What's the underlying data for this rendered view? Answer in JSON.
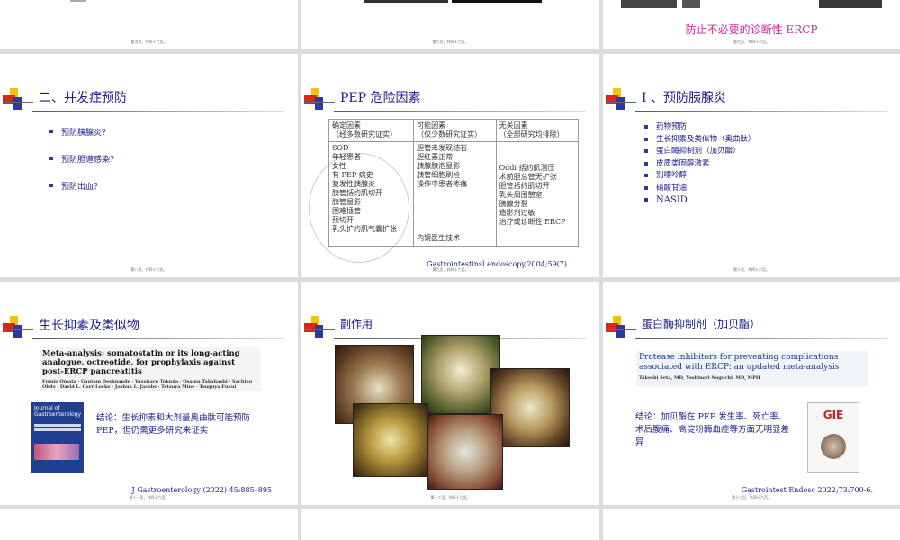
{
  "top_row": {
    "slide5_footer": "第五页，共四十六页。",
    "slide6_footer": "第六页，共四十六页。",
    "slide7_caption": "防止不必要的诊断性 ERCP",
    "slide7_footer": "第七页，共四十六页。"
  },
  "slide8": {
    "title": "二、并发症预防",
    "bullets": [
      "预防胰腺炎?",
      "预防胆道感染?",
      "预防出血?"
    ],
    "footer": "第八页，共四十六页。"
  },
  "slide9": {
    "title": "PEP 危险因素",
    "headers": [
      [
        "确定因素",
        "（经多数研究证实）"
      ],
      [
        "可能因素",
        "（仅少数研究证实）"
      ],
      [
        "无关因素",
        "（全部研究均排除）"
      ]
    ],
    "col1": [
      "SOD",
      "年轻患者",
      "女性",
      "有 PEP 病史",
      "复发性胰腺炎",
      "胰管括约肌切开",
      "胰管显影",
      "困难插管",
      "预切开",
      "乳头扩约肌气囊扩张"
    ],
    "col2": [
      "胆管未发现结石",
      "胆红素正常",
      "胰腺腺泡显影",
      "胰管细胞刷检",
      "操作中患者疼痛"
    ],
    "col2_bottom": "内镜医生技术",
    "col3": [
      "Oddi 括约肌测压",
      "术前胆总管无扩张",
      "胆管括约肌切开",
      "乳头周围憩室",
      "胰腺分裂",
      "造影剂过敏",
      "治疗或诊断性 ERCP"
    ],
    "reference": "Gastrointestinsl endoscopy,2004;59(7)",
    "footer": "第九页，共四十六页。"
  },
  "slide10": {
    "title": "I 、预防胰腺炎",
    "bullets": [
      "药物预防",
      "生长抑素及类似物（奥曲肽）",
      "蛋白酶抑制剂（加贝酯）",
      "皮质类固醇激素",
      "别嘌呤醇",
      "硝酸甘油",
      "NASID"
    ],
    "footer": "第十页，共四十六页。"
  },
  "slide11": {
    "title": "生长抑素及类似物",
    "paper_title": "Meta-analysis: somatostatin or its long-acting analogue, octreotide, for prophylaxis against post-ERCP pancreatitis",
    "paper_authors": "Fumio Omata · Gautam Deshpande · Yasuharu Tokuda · Osamu Takahashi · Sachiko Ohde · David L. Carr-Locke · Joshua L. Jacobs · Tetsuya Mine · Tsuguya Fukui",
    "journal_name": "Journal of Gastroenterology",
    "conclusion": "结论：生长抑素和大剂量奥曲肽可能预防 PEP，但仍需更多研究来证实",
    "reference": "J Gastroenterology (2022) 45:885–895",
    "footer": "第十一页，共四十六页。"
  },
  "slide12": {
    "title": "副作用",
    "footer": "第十二页，共四十六页。"
  },
  "slide13": {
    "title": "蛋白酶抑制剂（加贝酯）",
    "paper_title": "Protease inhibitors for preventing complications associated with ERCP: an updated meta-analysis",
    "paper_authors": "Takeshi Seta, MD, Yoshinori Noguchi, MD, MPH",
    "journal_name": "GIE",
    "conclusion": "结论：加贝酯在 PEP 发生率、死亡率、术后腹痛、高淀粉酶血症等方面无明显差异",
    "reference": "Gastrointest Endosc 2022;73:700-6.",
    "footer": "第十三页，共四十六页。"
  },
  "colors": {
    "title_blue": "#1a1a8c",
    "caption_magenta": "#cc2b9a",
    "logo_red": "#d9261c",
    "logo_yellow": "#f4c20d",
    "logo_navy": "#2b3a9c"
  }
}
